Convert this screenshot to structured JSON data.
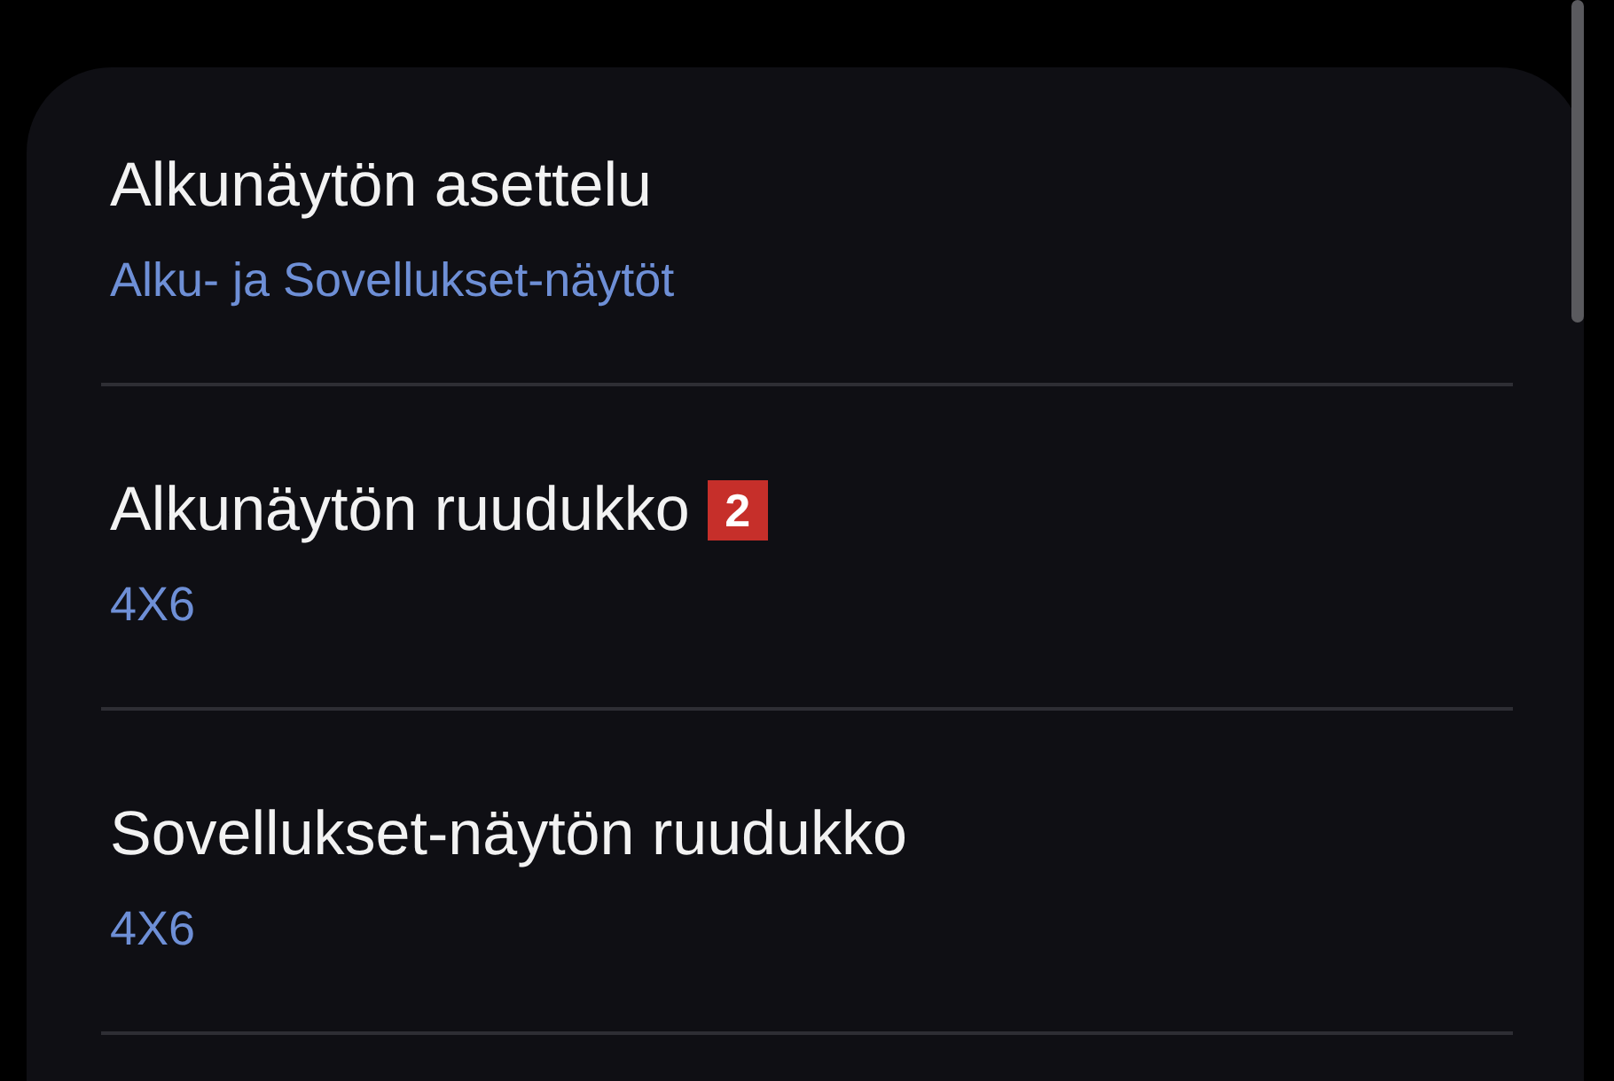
{
  "settings": [
    {
      "title": "Alkunäytön asettelu",
      "value": "Alku- ja Sovellukset-näytöt"
    },
    {
      "title": "Alkunäytön ruudukko",
      "value": "4X6",
      "badge": "2"
    },
    {
      "title": "Sovellukset-näytön ruudukko",
      "value": "4X6"
    }
  ]
}
